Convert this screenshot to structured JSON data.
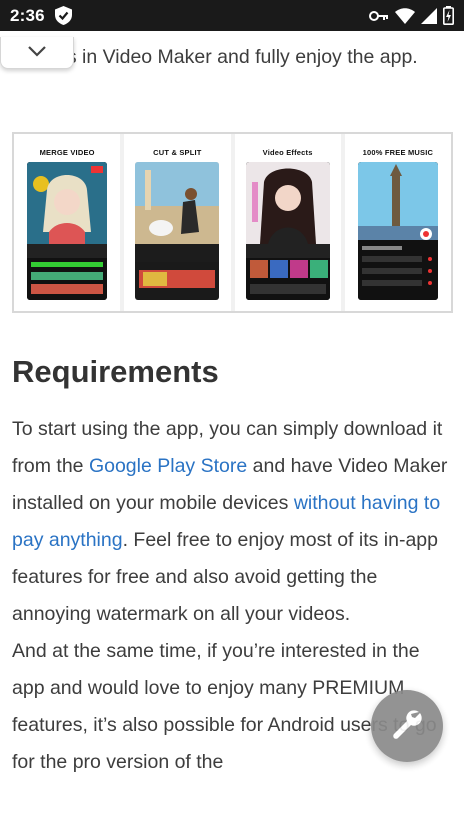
{
  "status_bar": {
    "time": "2:36",
    "icons": [
      "shield-icon",
      "vpn-key-icon",
      "wifi-icon",
      "signal-icon",
      "battery-icon"
    ]
  },
  "article": {
    "intro_text": "es in Video Maker and fully enjoy the app.",
    "promo_cards": [
      {
        "title": "MERGE VIDEO"
      },
      {
        "title": "CUT & SPLIT"
      },
      {
        "title": "Video Effects"
      },
      {
        "title": "100% FREE MUSIC"
      }
    ],
    "heading": "Requirements",
    "para1_part1": "To start using the app, you can simply download it from the ",
    "para1_link1": "Google Play Store",
    "para1_part2": " and have Video Maker installed on your mobile devices ",
    "para1_link2": "without having to pay anything",
    "para1_part3": ". Feel free to enjoy most of its in-app features for free and also avoid getting the annoying watermark on all your videos.",
    "para2": "And at the same time, if you’re interested in the app and would love to enjoy many PREMIUM features, it’s also possible for Android users to go for the pro version of the"
  },
  "fab": {
    "icon": "wrench-icon"
  },
  "colors": {
    "link": "#2a73c4",
    "status_bar": "#1a1a1a",
    "fab": "#8a8a8a"
  }
}
